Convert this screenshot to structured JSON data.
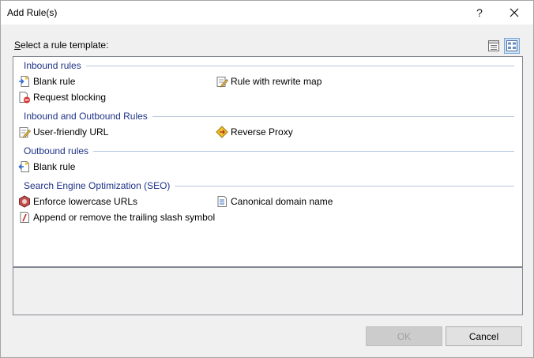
{
  "window": {
    "title": "Add Rule(s)",
    "help_label": "?",
    "close_label": "✕"
  },
  "select_label": "Select a rule template:",
  "groups": [
    {
      "header": "Inbound rules",
      "items": [
        {
          "label": "Blank rule"
        },
        {
          "label": "Rule with rewrite map"
        },
        {
          "label": "Request blocking"
        }
      ]
    },
    {
      "header": "Inbound and Outbound Rules",
      "items": [
        {
          "label": "User-friendly URL"
        },
        {
          "label": "Reverse Proxy"
        }
      ]
    },
    {
      "header": "Outbound rules",
      "items": [
        {
          "label": "Blank rule"
        }
      ]
    },
    {
      "header": "Search Engine Optimization (SEO)",
      "items": [
        {
          "label": "Enforce lowercase URLs"
        },
        {
          "label": "Canonical domain name"
        },
        {
          "label": "Append or remove the trailing slash symbol"
        }
      ]
    }
  ],
  "buttons": {
    "ok": "OK",
    "cancel": "Cancel"
  },
  "colors": {
    "group_header": "#1e3287",
    "group_line": "#b9c9df",
    "selected_view": "#cde3f8"
  }
}
